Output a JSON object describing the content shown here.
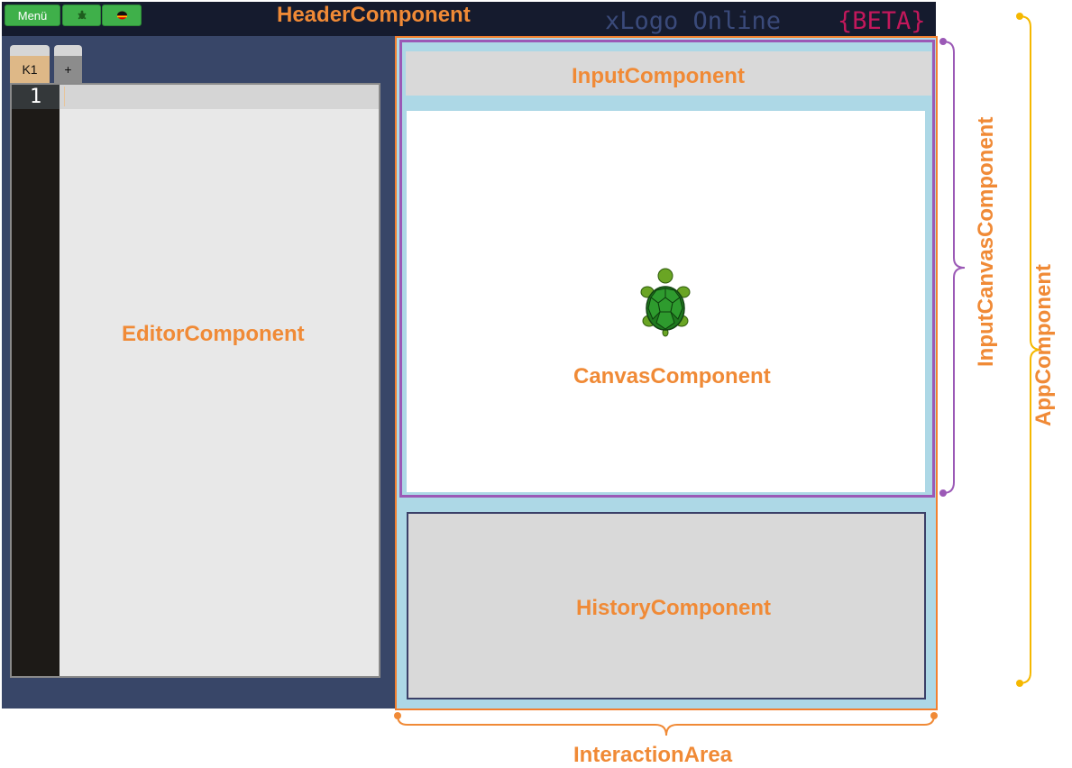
{
  "header": {
    "menu_label": "Menü",
    "brand_title": "xLogo Online",
    "brand_badge": "{BETA}"
  },
  "editor": {
    "tabs": [
      {
        "label": "K1"
      },
      {
        "label": "+"
      }
    ],
    "line_number": "1"
  },
  "labels": {
    "header_component": "HeaderComponent",
    "editor_component": "EditorComponent",
    "input_component": "InputComponent",
    "canvas_component": "CanvasComponent",
    "history_component": "HistoryComponent",
    "input_canvas_component": "InputCanvasComponent",
    "app_component": "AppComponent",
    "interaction_area": "InteractionArea"
  },
  "colors": {
    "label_orange": "#f08a36",
    "bracket_purple": "#9b59b6",
    "bracket_yellow": "#f5b800",
    "badge_pink": "#c2185b",
    "brand_blue": "#3a4a7a"
  },
  "icons": [
    "turtle-icon",
    "german-flag-icon"
  ]
}
